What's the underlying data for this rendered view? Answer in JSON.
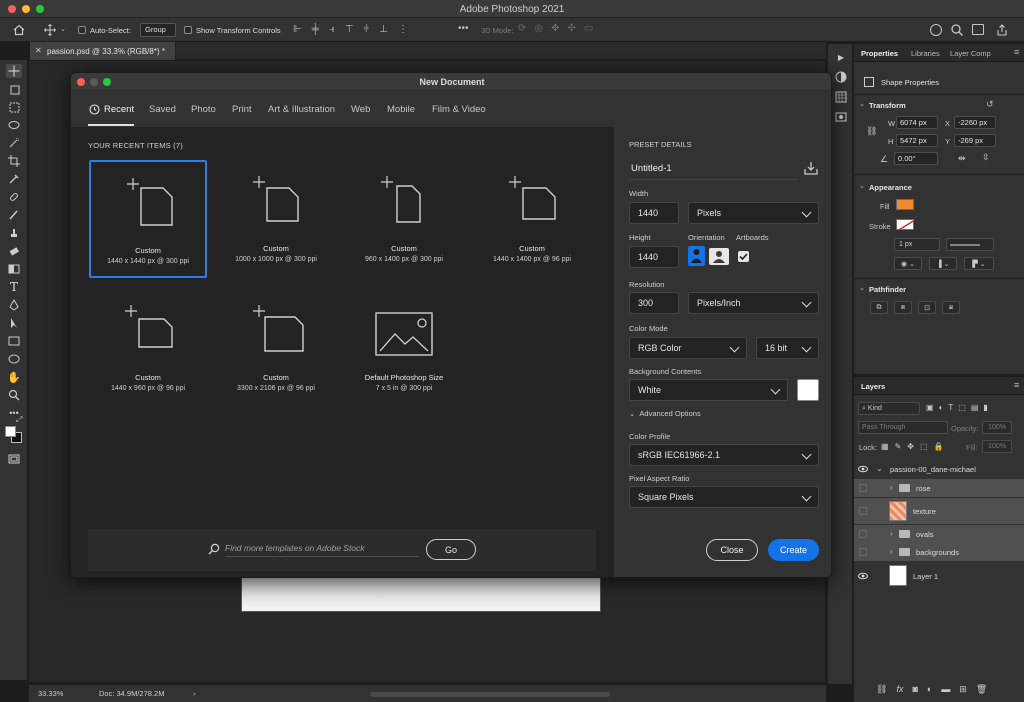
{
  "app": {
    "title": "Adobe Photoshop 2021"
  },
  "options_bar": {
    "auto_select_label": "Auto-Select:",
    "auto_select_value": "Group",
    "show_transform_label": "Show Transform Controls",
    "mode_3d_label": "3D Mode:"
  },
  "document_tab": {
    "label": "passion.psd @ 33.3% (RGB/8*) *"
  },
  "status_bar": {
    "zoom": "33.33%",
    "doc_info": "Doc: 34.9M/278.2M"
  },
  "dialog": {
    "title": "New Document",
    "tabs": [
      "Recent",
      "Saved",
      "Photo",
      "Print",
      "Art & Illustration",
      "Web",
      "Mobile",
      "Film & Video"
    ],
    "recent_header": "YOUR RECENT ITEMS  (7)",
    "items": [
      {
        "name": "Custom",
        "size": "1440 x 1440 px @ 300 ppi",
        "icon": "square-doc-icon"
      },
      {
        "name": "Custom",
        "size": "1000 x 1000 px @ 300 ppi",
        "icon": "square-doc-icon"
      },
      {
        "name": "Custom",
        "size": "960 x 1400 px @ 300 ppi",
        "icon": "portrait-doc-icon"
      },
      {
        "name": "Custom",
        "size": "1440 x 1400 px @ 96 ppi",
        "icon": "square-doc-icon"
      },
      {
        "name": "Custom",
        "size": "1440 x 960 px @ 96 ppi",
        "icon": "landscape-doc-icon"
      },
      {
        "name": "Custom",
        "size": "3300 x 2106 px @ 96 ppi",
        "icon": "landscape-doc-icon"
      },
      {
        "name": "Default Photoshop Size",
        "size": "7 x 5 in @ 300 ppi",
        "icon": "image-placeholder-icon"
      }
    ],
    "search": {
      "placeholder": "Find more templates on Adobe Stock",
      "go_label": "Go"
    },
    "preset": {
      "header": "PRESET DETAILS",
      "name": "Untitled-1",
      "width_label": "Width",
      "width_value": "1440",
      "width_unit": "Pixels",
      "height_label": "Height",
      "height_value": "1440",
      "orientation_label": "Orientation",
      "artboards_label": "Artboards",
      "resolution_label": "Resolution",
      "resolution_value": "300",
      "resolution_unit": "Pixels/Inch",
      "color_mode_label": "Color Mode",
      "color_mode_value": "RGB Color",
      "bit_depth": "16 bit",
      "background_label": "Background Contents",
      "background_value": "White",
      "advanced_label": "Advanced Options",
      "color_profile_label": "Color Profile",
      "color_profile_value": "sRGB IEC61966-2.1",
      "pixel_aspect_label": "Pixel Aspect Ratio",
      "pixel_aspect_value": "Square Pixels",
      "close_label": "Close",
      "create_label": "Create"
    }
  },
  "properties": {
    "tabs": [
      "Properties",
      "Libraries",
      "Layer Comp"
    ],
    "kind": "Shape Properties",
    "transform_label": "Transform",
    "w_label": "W",
    "w_value": "6074 px",
    "x_label": "X",
    "x_value": "-2260 px",
    "h_label": "H",
    "h_value": "5472 px",
    "y_label": "Y",
    "y_value": "-269 px",
    "angle_value": "0.00°",
    "appearance_label": "Appearance",
    "fill_label": "Fill",
    "stroke_label": "Stroke",
    "stroke_width": "1 px",
    "pathfinder_label": "Pathfinder",
    "fill_color": "#f08a2c"
  },
  "layers": {
    "tab": "Layers",
    "filter_value": "Kind",
    "blend_mode": "Pass Through",
    "opacity_label": "Opacity:",
    "opacity_value": "100%",
    "lock_label": "Lock:",
    "fill_label": "Fill:",
    "fill_value": "100%",
    "items": [
      {
        "name": "passion-00_dane-michael",
        "type": "group"
      },
      {
        "name": "rose",
        "type": "folder"
      },
      {
        "name": "texture",
        "type": "image"
      },
      {
        "name": "ovals",
        "type": "folder"
      },
      {
        "name": "backgrounds",
        "type": "folder"
      },
      {
        "name": "Layer 1",
        "type": "layer"
      }
    ]
  }
}
